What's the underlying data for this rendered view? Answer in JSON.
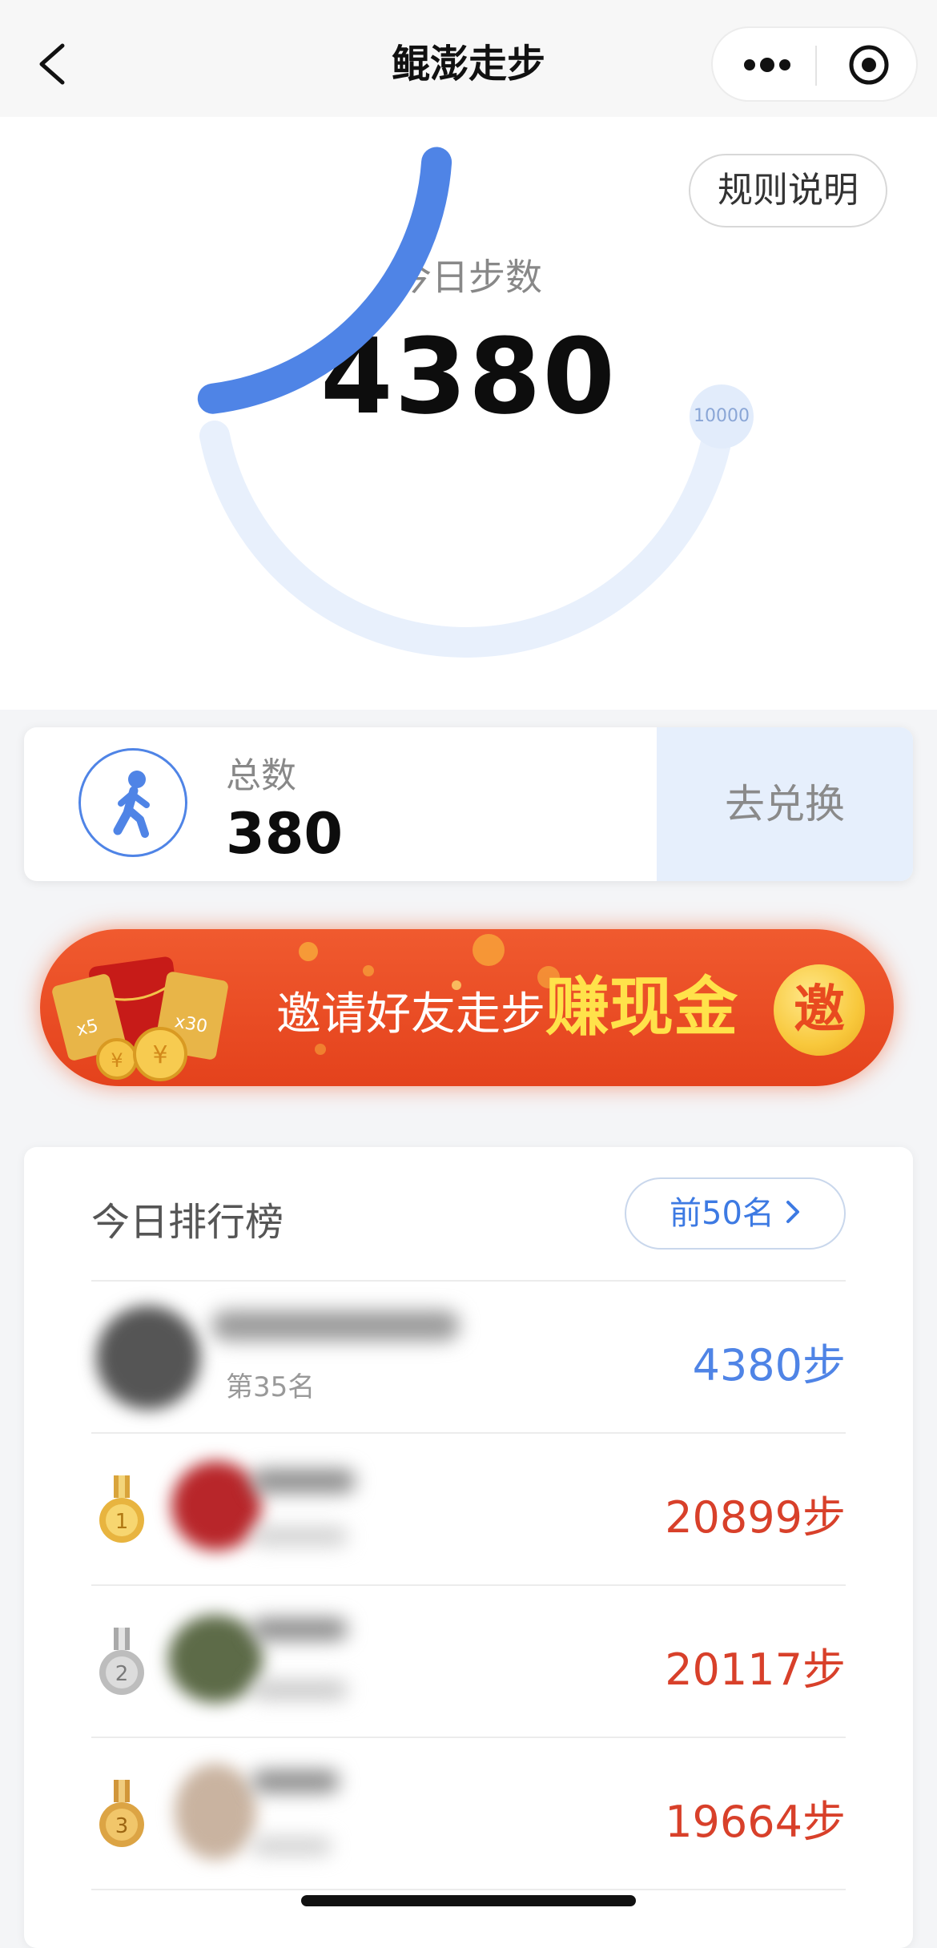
{
  "navbar": {
    "title": "鲲澎走步"
  },
  "rules_button": "规则说明",
  "today": {
    "label": "今日步数",
    "steps": "4380",
    "goal": "10000",
    "progress": 0.438
  },
  "total": {
    "label": "总数",
    "value": "380",
    "exchange_label": "去兑换"
  },
  "invite": {
    "text": "邀请好友走步",
    "highlight": "赚现金",
    "badge": "邀",
    "coupons": [
      "x5",
      "x30"
    ]
  },
  "ranking": {
    "title": "今日排行榜",
    "top_button": "前50名",
    "me": {
      "rank_label": "第35名",
      "steps": "4380步"
    },
    "rows": [
      {
        "medal": "1",
        "steps": "20899步"
      },
      {
        "medal": "2",
        "steps": "20117步"
      },
      {
        "medal": "3",
        "steps": "19664步"
      }
    ]
  },
  "colors": {
    "accent": "#4f84e6",
    "rank_red": "#d8402a",
    "banner": "#e8471f",
    "gold": "#ffe24a"
  }
}
